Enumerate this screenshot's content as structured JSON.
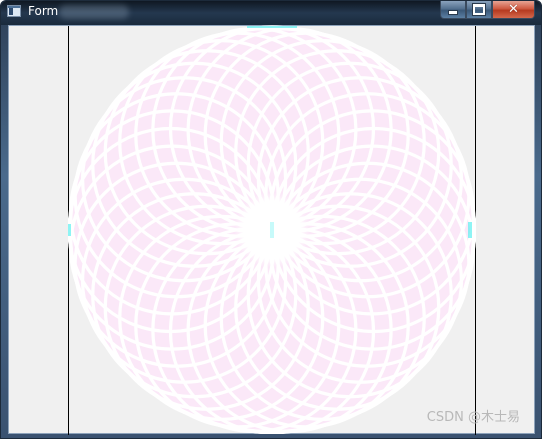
{
  "window": {
    "title": "Form",
    "icon": "app-window-icon",
    "buttons": {
      "minimize": "minimize-icon",
      "maximize": "maximize-icon",
      "close": "close-icon"
    }
  },
  "canvas": {
    "pattern": "spirograph-circles",
    "fill_color": "#fbe8f8",
    "stroke_color": "#ffffff",
    "accent_color": "#5ef0f0",
    "circle_count": 36
  },
  "watermark": "CSDN @木士易"
}
